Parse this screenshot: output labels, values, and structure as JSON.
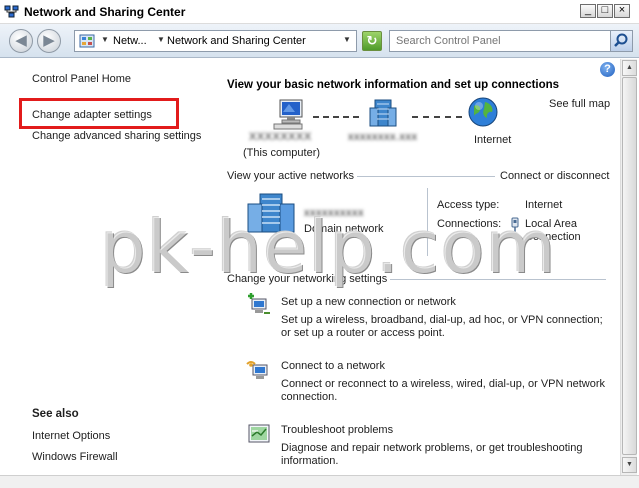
{
  "window": {
    "title": "Network and Sharing Center",
    "min_glyph": "_",
    "max_glyph": "□",
    "close_glyph": "×"
  },
  "nav": {
    "back_glyph": "◀",
    "forward_glyph": "▶",
    "breadcrumb": [
      "Netw...",
      "Network and Sharing Center"
    ],
    "search_placeholder": "Search Control Panel"
  },
  "left_pane": {
    "home_link": "Control Panel Home",
    "links": [
      "Change adapter settings",
      "Change advanced sharing settings"
    ],
    "see_also_heading": "See also",
    "see_also": [
      "Internet Options",
      "Windows Firewall"
    ]
  },
  "main": {
    "heading": "View your basic network information and set up connections",
    "see_full_map": "See full map",
    "map": {
      "computer_name": "XXXXXXXX",
      "this_computer": "(This computer)",
      "domain_name": "xxxxxxxx.xxx",
      "internet": "Internet"
    },
    "active": {
      "title": "View your active networks",
      "connect_link": "Connect or disconnect",
      "network_name": "xxxxxxxxxx",
      "network_type": "Domain network",
      "access_type_label": "Access type:",
      "access_type_value": "Internet",
      "connections_label": "Connections:",
      "connection_value": "Local Area Connection"
    },
    "settings": {
      "title": "Change your networking settings",
      "tasks": [
        {
          "title": "Set up a new connection or network",
          "desc": "Set up a wireless, broadband, dial-up, ad hoc, or VPN connection; or set up a router or access point."
        },
        {
          "title": "Connect to a network",
          "desc": "Connect or reconnect to a wireless, wired, dial-up, or VPN network connection."
        },
        {
          "title": "Troubleshoot problems",
          "desc": "Diagnose and repair network problems, or get troubleshooting information."
        }
      ]
    }
  },
  "watermark": "pk-help.com",
  "colors": {
    "highlight": "#e21b1b",
    "separator": "#b9c3cf"
  }
}
